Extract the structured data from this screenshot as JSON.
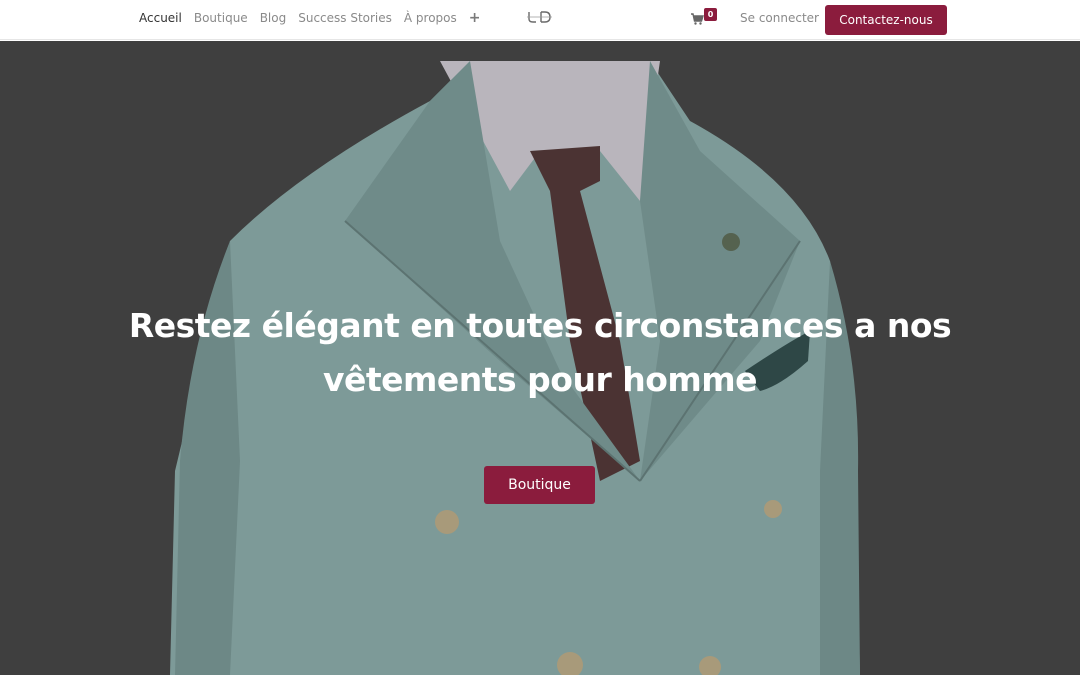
{
  "nav": {
    "items": [
      {
        "label": "Accueil",
        "active": true
      },
      {
        "label": "Boutique",
        "active": false
      },
      {
        "label": "Blog",
        "active": false
      },
      {
        "label": "Success Stories",
        "active": false
      },
      {
        "label": "À propos",
        "active": false
      }
    ],
    "more_icon": "plus-icon"
  },
  "logo": {
    "icon": "brand-logo"
  },
  "cart": {
    "icon": "cart-icon",
    "count": "0"
  },
  "header": {
    "login_label": "Se connecter",
    "contact_label": "Contactez-nous"
  },
  "hero": {
    "title": "Restez élégant en toutes circonstances a nos vêtements pour homme",
    "button_label": "Boutique",
    "image": "man-in-light-blue-double-breasted-suit"
  },
  "colors": {
    "accent": "#8b1c3d",
    "hero_overlay": "#3f3f3f",
    "suit": "#7d9a98",
    "tie": "#4b3333"
  }
}
